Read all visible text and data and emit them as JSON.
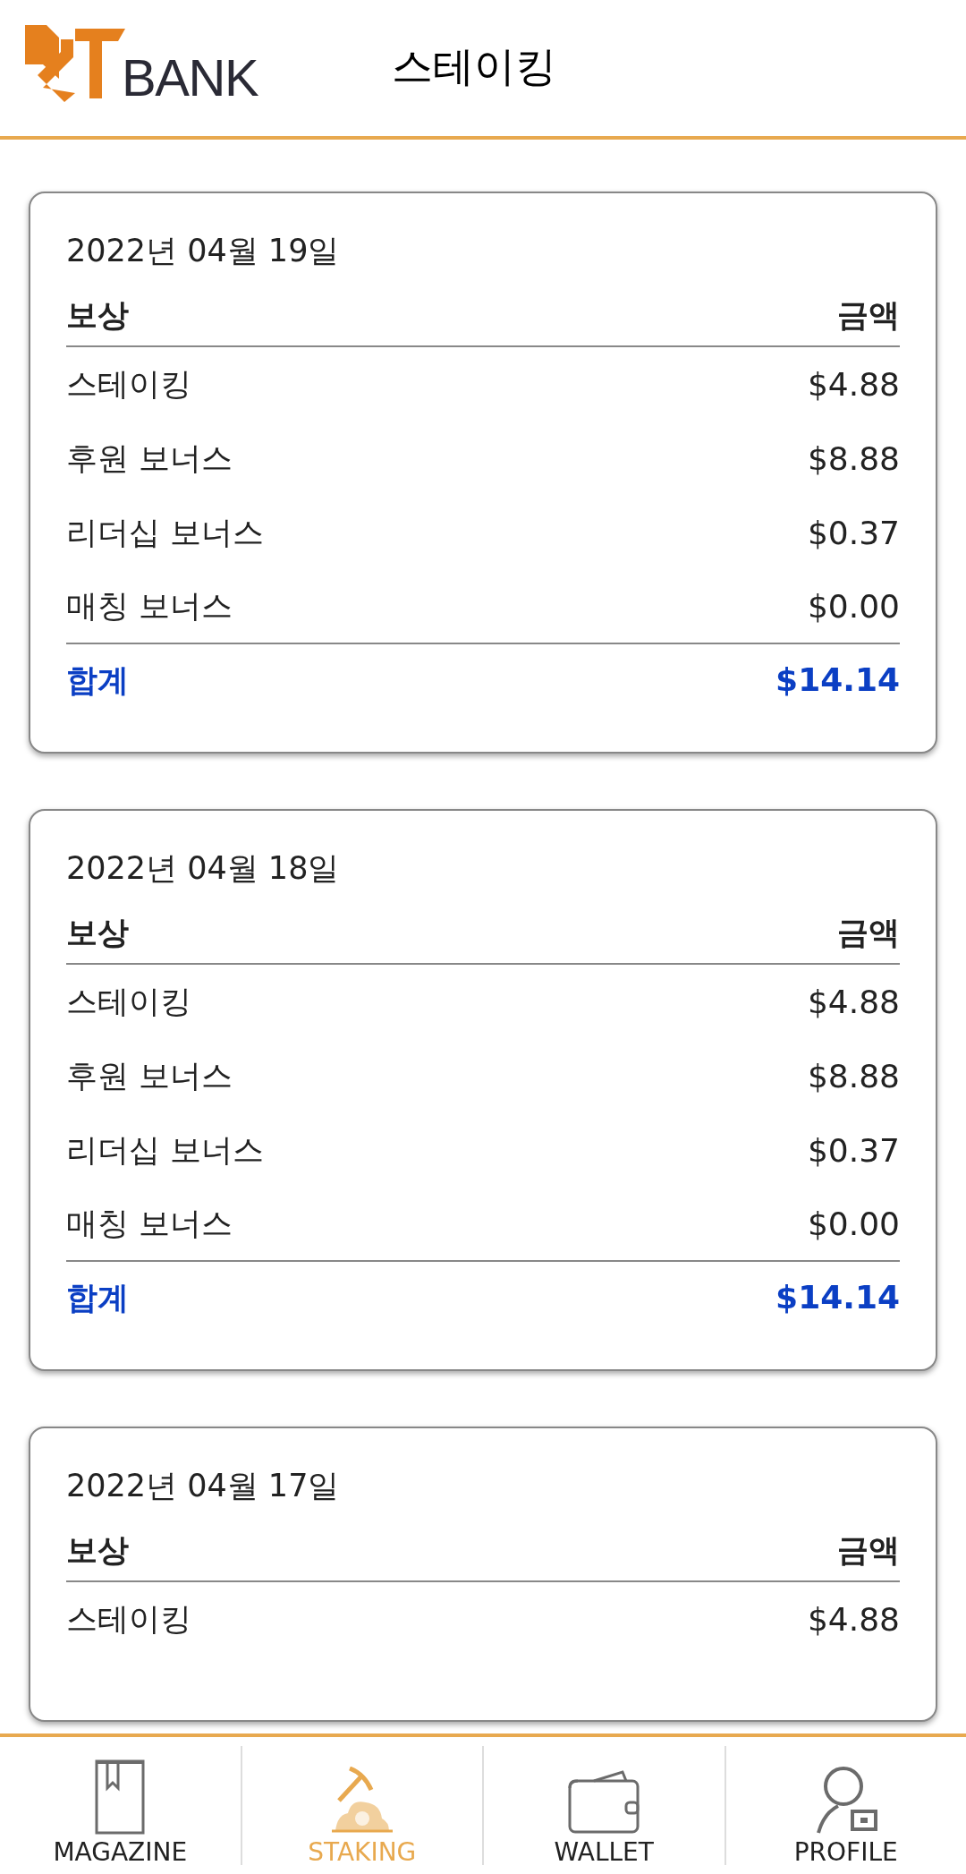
{
  "header": {
    "logo_text": "BANK",
    "title": "스테이킹"
  },
  "cards": [
    {
      "date": "2022년 04월 19일",
      "columns": [
        "보상",
        "금액"
      ],
      "rows": [
        {
          "label": "스테이킹",
          "amount": "$4.88"
        },
        {
          "label": "후원 보너스",
          "amount": "$8.88"
        },
        {
          "label": "리더십 보너스",
          "amount": "$0.37"
        },
        {
          "label": "매칭 보너스",
          "amount": "$0.00"
        }
      ],
      "total": {
        "label": "합계",
        "amount": "$14.14"
      }
    },
    {
      "date": "2022년 04월 18일",
      "columns": [
        "보상",
        "금액"
      ],
      "rows": [
        {
          "label": "스테이킹",
          "amount": "$4.88"
        },
        {
          "label": "후원 보너스",
          "amount": "$8.88"
        },
        {
          "label": "리더십 보너스",
          "amount": "$0.37"
        },
        {
          "label": "매칭 보너스",
          "amount": "$0.00"
        }
      ],
      "total": {
        "label": "합계",
        "amount": "$14.14"
      }
    },
    {
      "date": "2022년 04월 17일",
      "columns": [
        "보상",
        "금액"
      ],
      "rows": [
        {
          "label": "스테이킹",
          "amount": "$4.88"
        }
      ]
    }
  ],
  "nav": [
    {
      "kind": "magazine",
      "label": "MAGAZINE",
      "selected": false
    },
    {
      "kind": "staking",
      "label": "STAKING",
      "selected": true
    },
    {
      "kind": "wallet",
      "label": "WALLET",
      "selected": false
    },
    {
      "kind": "profile",
      "label": "PROFILE",
      "selected": false
    }
  ]
}
